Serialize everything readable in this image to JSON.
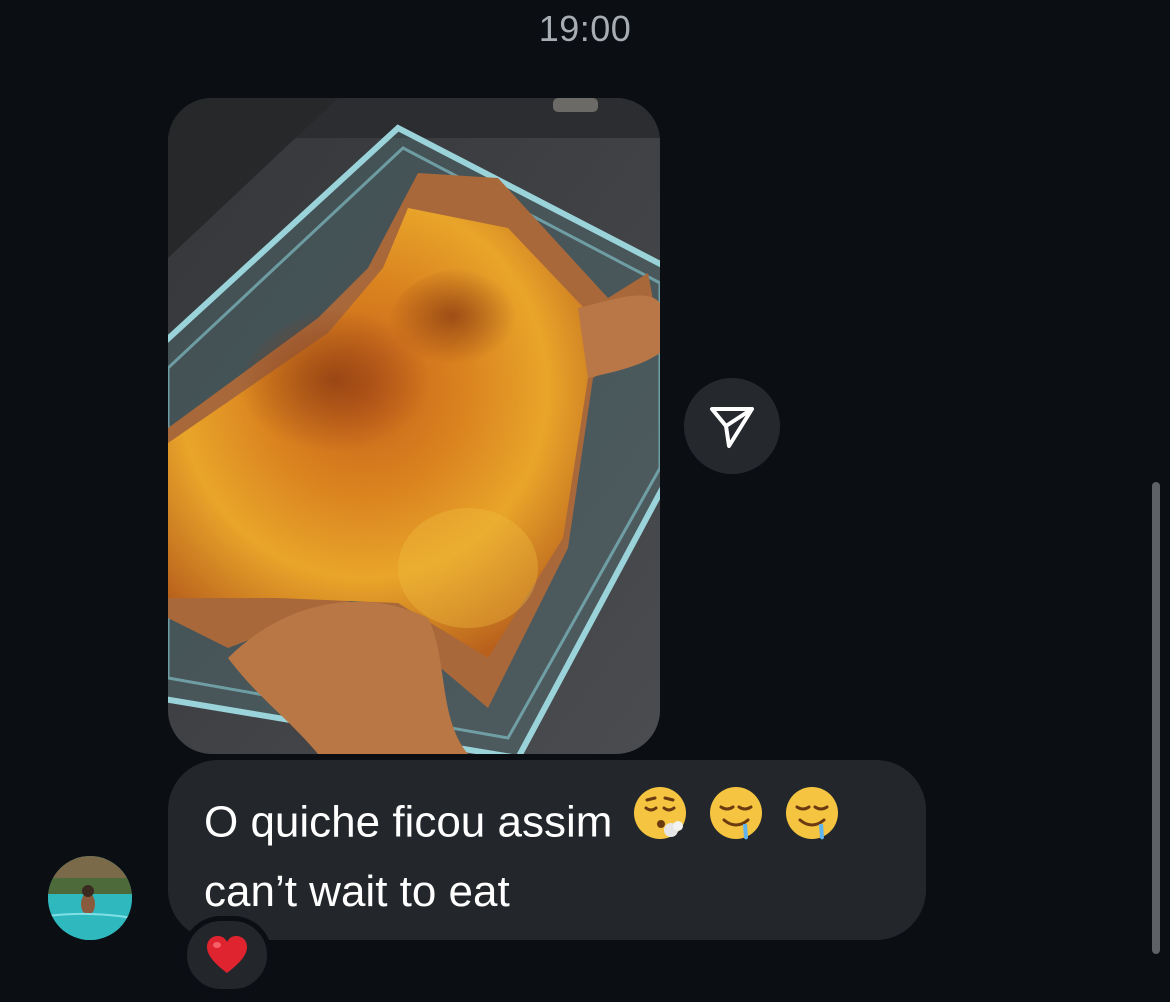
{
  "thread": {
    "timestamp": "19:00"
  },
  "message": {
    "image_alt": "Photo of a baked quiche in a glass dish",
    "line1": "O quiche ficou assim",
    "line2": "can’t wait to eat",
    "emojis": [
      "exhale-face-emoji",
      "drooling-face-emoji",
      "drooling-face-emoji"
    ],
    "reaction": "heart-emoji"
  },
  "share_button": {
    "icon": "paper-plane-icon"
  },
  "colors": {
    "background": "#0b0f14",
    "bubble": "#23272c",
    "timestamp": "#a8acb3",
    "heart": "#e0242f"
  }
}
